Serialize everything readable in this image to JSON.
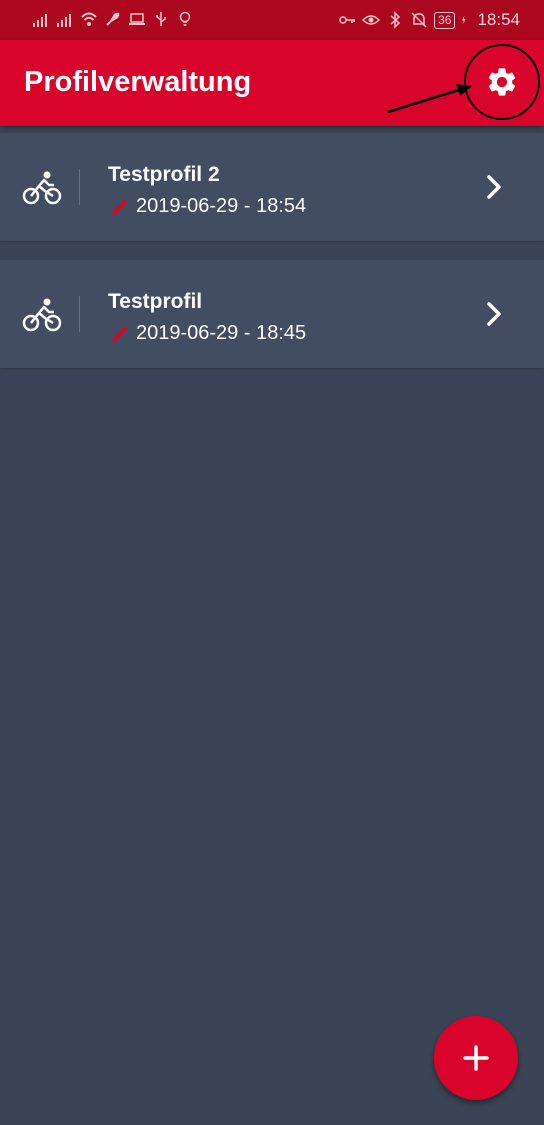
{
  "status_bar": {
    "time": "18:54",
    "battery": "36",
    "icons": [
      "signal-icon",
      "signal-icon",
      "wifi-icon",
      "rocket-icon",
      "laptop-icon",
      "usb-icon",
      "lightbulb-icon",
      "key-icon",
      "eye-icon",
      "bluetooth-icon",
      "bell-off-icon",
      "battery-icon",
      "charging-icon"
    ]
  },
  "app_bar": {
    "title": "Profilverwaltung",
    "settings_icon": "gear-icon"
  },
  "profiles": [
    {
      "name": "Testprofil 2",
      "date": "2019-06-29 - 18:54",
      "icon": "bicycle-icon"
    },
    {
      "name": "Testprofil",
      "date": "2019-06-29 - 18:45",
      "icon": "bicycle-icon"
    }
  ],
  "fab": {
    "icon": "plus-icon"
  },
  "colors": {
    "accent": "#d9042b",
    "status_bar": "#ab0820",
    "background": "#3b4456",
    "card": "#434d61"
  }
}
